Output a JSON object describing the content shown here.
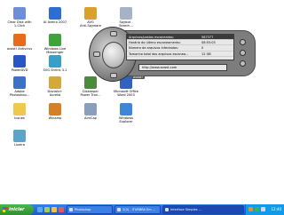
{
  "desktop_icons": [
    {
      "label": "Clear Disk with\n1-Click",
      "color": "#6c8fd8",
      "icon": "clear-disk-icon"
    },
    {
      "label": "AI Aveiro 2007",
      "color": "#2d6fd0",
      "icon": "app-icon"
    },
    {
      "label": "AVG\nAnti-Spyware",
      "color": "#d9a02a",
      "icon": "avg-icon"
    },
    {
      "label": "Spybot -\nSearch...",
      "color": "#a6b3c7",
      "icon": "spybot-icon"
    },
    {
      "label": "avast! Antivirus",
      "color": "#e86b1c",
      "icon": "avast-icon"
    },
    {
      "label": "Windows Live\nMessenger",
      "color": "#3fa33c",
      "icon": "messenger-icon"
    },
    {
      "label": "PowerDVD",
      "color": "#2757c4",
      "icon": "dvd-icon"
    },
    {
      "label": "SVG Shrink 3.1",
      "color": "#37a0c8",
      "icon": "svg-icon"
    },
    {
      "label": "Adobe\nPhotoshop...",
      "color": "#3b72c8",
      "icon": "photoshop-icon"
    },
    {
      "label": "Dovrolo+\nAurelia",
      "color": "#d4a93a",
      "icon": "app-icon"
    },
    {
      "label": "Diskeeper\nPower Tran...",
      "color": "#4d8b3c",
      "icon": "diskeeper-icon"
    },
    {
      "label": "Microsoft Office\nWord 2003",
      "color": "#3162bd",
      "icon": "word-icon"
    },
    {
      "label": "Icones",
      "color": "#f0c94a",
      "icon": "folder-icon"
    },
    {
      "label": "Winamp",
      "color": "#d48126",
      "icon": "winamp-icon"
    },
    {
      "label": "AimCap",
      "color": "#8a9fba",
      "icon": "aimcap-icon"
    },
    {
      "label": "Windows\nExplorer",
      "color": "#3f86d8",
      "icon": "explorer-icon"
    },
    {
      "label": "Lixeira",
      "color": "#5aa5c9",
      "icon": "recycle-bin-icon"
    }
  ],
  "avast": {
    "brand": "avast!",
    "rows": [
      {
        "label": "Arquivos/pastas escaneados:",
        "value": "587377"
      },
      {
        "label": "Horário do último escaneamento:",
        "value": "08:55:05"
      },
      {
        "label": "Número de arquivos infectados:",
        "value": "0"
      },
      {
        "label": "Tamanho total dos arquivos escanea...",
        "value": "12 GB"
      }
    ],
    "url": "http://www.avast.com"
  },
  "taskbar": {
    "start_label": "iniciar",
    "tasks": [
      "Photoshop",
      "2(0) - ITURBRA Em ...",
      "Interface Simples ..."
    ],
    "clock": "12:40"
  }
}
